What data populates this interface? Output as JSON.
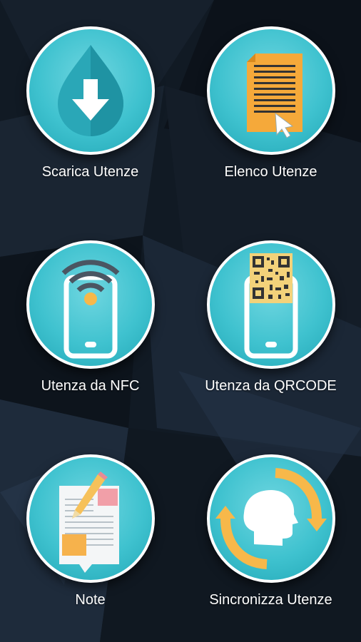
{
  "menu": {
    "items": [
      {
        "label": "Scarica Utenze",
        "icon": "download-icon"
      },
      {
        "label": "Elenco Utenze",
        "icon": "document-list-icon"
      },
      {
        "label": "Utenza da NFC",
        "icon": "nfc-phone-icon"
      },
      {
        "label": "Utenza da QRCODE",
        "icon": "qrcode-phone-icon"
      },
      {
        "label": "Note",
        "icon": "notes-icon"
      },
      {
        "label": "Sincronizza Utenze",
        "icon": "sync-icon"
      }
    ]
  },
  "colors": {
    "circle": "#3fc2cf",
    "circle_border": "#ffffff",
    "accent_orange": "#f7b84a",
    "background": "#0f1620"
  }
}
